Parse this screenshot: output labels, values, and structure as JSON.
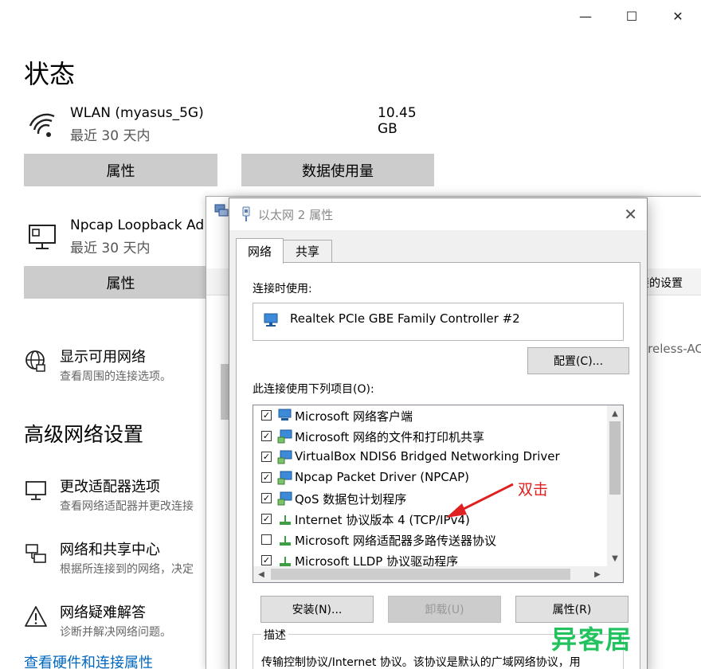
{
  "settings": {
    "title": "状态",
    "window_controls": {
      "minimize": "—",
      "maximize": "☐",
      "close": "✕"
    },
    "networks": [
      {
        "name": "WLAN (myasus_5G)",
        "period": "最近 30 天内",
        "usage": "10.45 GB",
        "icon": "wifi-icon"
      },
      {
        "name": "Npcap Loopback Ad",
        "period": "最近 30 天内",
        "icon": "ethernet-pc-icon"
      }
    ],
    "buttons": {
      "properties": "属性",
      "data_usage": "数据使用量",
      "properties2": "属性"
    },
    "show_networks": {
      "title": "显示可用网络",
      "sub": "查看周围的连接选项。"
    },
    "advanced_heading": "高级网络设置",
    "advanced": [
      {
        "title": "更改适配器选项",
        "sub": "查看网络适配器并更改连接"
      },
      {
        "title": "网络和共享中心",
        "sub": "根据所连接到的网络，决定"
      },
      {
        "title": "网络疑难解答",
        "sub": "诊断并解决网络问题。"
      }
    ],
    "hardware_link": "查看硬件和连接属性"
  },
  "background_window": {
    "right_text1": "接的设置",
    "right_text2": "ireless-AC"
  },
  "dialog": {
    "title": "以太网 2 属性",
    "close": "✕",
    "tabs": [
      "网络",
      "共享"
    ],
    "connect_using_label": "连接时使用:",
    "adapter": "Realtek PCIe GBE Family Controller #2",
    "configure_button": "配置(C)...",
    "items_label": "此连接使用下列项目(O):",
    "items": [
      {
        "checked": true,
        "text": "Microsoft 网络客户端",
        "icon": "network-client-icon"
      },
      {
        "checked": true,
        "text": "Microsoft 网络的文件和打印机共享",
        "icon": "network-service-icon"
      },
      {
        "checked": true,
        "text": "VirtualBox NDIS6 Bridged Networking Driver",
        "icon": "network-service-icon"
      },
      {
        "checked": true,
        "text": "Npcap Packet Driver (NPCAP)",
        "icon": "network-service-icon"
      },
      {
        "checked": true,
        "text": "QoS 数据包计划程序",
        "icon": "network-service-icon"
      },
      {
        "checked": true,
        "text": "Internet 协议版本 4 (TCP/IPv4)",
        "icon": "protocol-icon"
      },
      {
        "checked": false,
        "text": "Microsoft 网络适配器多路传送器协议",
        "icon": "protocol-icon"
      },
      {
        "checked": true,
        "text": "Microsoft LLDP 协议驱动程序",
        "icon": "protocol-icon"
      }
    ],
    "install_button": "安装(N)...",
    "uninstall_button": "卸载(U)",
    "properties_button": "属性(R)",
    "description_legend": "描述",
    "description_text": "传输控制协议/Internet 协议。该协议是默认的广域网络协议，用"
  },
  "annotation": {
    "text": "双击",
    "color": "#e02020"
  },
  "watermark": {
    "text": "异客居",
    "color": "#22c35e"
  }
}
